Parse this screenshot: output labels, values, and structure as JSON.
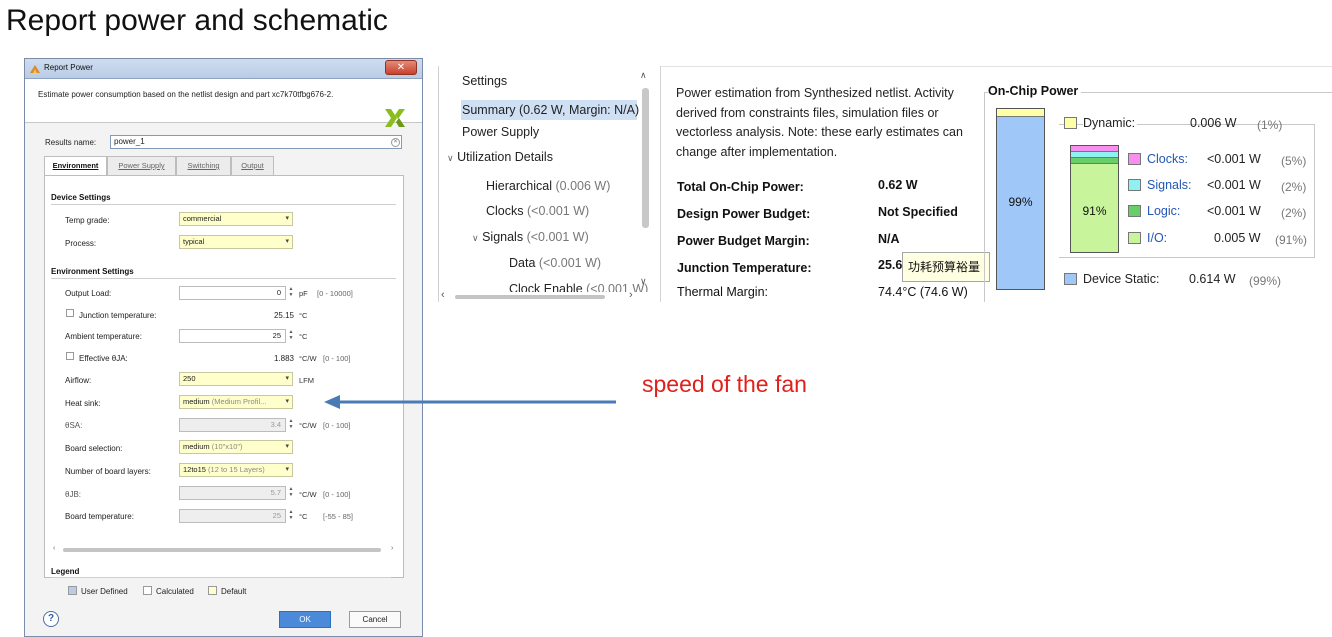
{
  "slide": {
    "title": "Report power and schematic"
  },
  "dialog": {
    "title": "Report Power",
    "close": "✕",
    "description": "Estimate power consumption based on the netlist design and part xc7k70tfbg676-2.",
    "results_name_label": "Results name:",
    "results_name_value": "power_1",
    "tabs": [
      "Environment",
      "Power Supply",
      "Switching",
      "Output"
    ],
    "device_settings": {
      "heading": "Device Settings",
      "temp_grade": {
        "label": "Temp grade:",
        "value": "commercial"
      },
      "process": {
        "label": "Process:",
        "value": "typical"
      }
    },
    "environment_settings": {
      "heading": "Environment Settings",
      "output_load": {
        "label": "Output Load:",
        "value": "0",
        "unit": "pF",
        "range": "[0 - 10000]"
      },
      "junction_temperature": {
        "label": "Junction temperature:",
        "value": "25.15",
        "unit": "°C"
      },
      "ambient_temperature": {
        "label": "Ambient temperature:",
        "value": "25",
        "unit": "°C"
      },
      "effective_theta_ja": {
        "label": "Effective θJA:",
        "value": "1.883",
        "unit": "°C/W",
        "range": "[0 - 100]"
      },
      "airflow": {
        "label": "Airflow:",
        "value": "250",
        "unit": "LFM"
      },
      "heat_sink": {
        "label": "Heat sink:",
        "value": "medium",
        "extra": "(Medium Profil..."
      },
      "theta_sa": {
        "label": "θSA:",
        "value": "3.4",
        "unit": "°C/W",
        "range": "[0 - 100]"
      },
      "board_selection": {
        "label": "Board selection:",
        "value": "medium",
        "extra": "(10\"x10\")"
      },
      "board_layers": {
        "label": "Number of board layers:",
        "value": "12to15",
        "extra": "(12 to 15 Layers)"
      },
      "theta_jb": {
        "label": "θJB:",
        "value": "5.7",
        "unit": "°C/W",
        "range": "[0 - 100]"
      },
      "board_temperature": {
        "label": "Board temperature:",
        "value": "25",
        "unit": "°C",
        "range": "[-55 - 85]"
      }
    },
    "legend": {
      "heading": "Legend",
      "user_defined": "User Defined",
      "calculated": "Calculated",
      "default": "Default",
      "colors": {
        "user_defined": "#b9cde8",
        "calculated": "#ffffff",
        "default": "#ffffcc"
      }
    },
    "help": "?",
    "ok": "OK",
    "cancel": "Cancel"
  },
  "annotation": {
    "text": "speed of the fan",
    "color": "#e0201c",
    "arrow_color": "#4a7bb5"
  },
  "summary": {
    "nav": {
      "settings": "Settings",
      "summary": "Summary (0.62 W, Margin: N/A)",
      "power_supply": "Power Supply",
      "utilization_details": "Utilization Details",
      "hierarchical": "Hierarchical",
      "hierarchical_value": "(0.006 W)",
      "clocks": "Clocks",
      "clocks_value": "(<0.001 W)",
      "signals": "Signals",
      "signals_value": "(<0.001 W)",
      "data": "Data",
      "data_value": "(<0.001 W)",
      "clock_enable": "Clock Enable",
      "clock_enable_value": "(<0.001 W)"
    },
    "description": "Power estimation from Synthesized netlist. Activity derived from constraints files, simulation files or vectorless analysis. Note: these early estimates can change after implementation.",
    "rows": {
      "total_on_chip_power": {
        "label": "Total On-Chip Power:",
        "value": "0.62 W"
      },
      "design_power_budget": {
        "label": "Design Power Budget:",
        "value": "Not Specified"
      },
      "power_budget_margin": {
        "label": "Power Budget Margin:",
        "value": "N/A"
      },
      "junction_temperature": {
        "label": "Junction Temperature:",
        "value": "25.6"
      },
      "thermal_margin": {
        "label": "Thermal Margin:",
        "value": "74.4°C (74.6 W)"
      }
    },
    "tooltip": "功耗预算裕量",
    "on_chip": {
      "title": "On-Chip Power",
      "big_bar_percent": "99%",
      "small_bar_percent": "91%",
      "dynamic": {
        "label": "Dynamic:",
        "value": "0.006 W",
        "percent": "(1%)",
        "color": "#ffffa8"
      },
      "clocks": {
        "label": "Clocks:",
        "value": "<0.001 W",
        "percent": "(5%)",
        "color": "#f78ef0"
      },
      "signals": {
        "label": "Signals:",
        "value": "<0.001 W",
        "percent": "(2%)",
        "color": "#8ff2f2"
      },
      "logic": {
        "label": "Logic:",
        "value": "<0.001 W",
        "percent": "(2%)",
        "color": "#68cf68"
      },
      "io": {
        "label": "I/O:",
        "value": "0.005 W",
        "percent": "(91%)",
        "color": "#c8f49b"
      },
      "device_static": {
        "label": "Device Static:",
        "value": "0.614 W",
        "percent": "(99%)",
        "color": "#9fc7f7"
      }
    }
  }
}
